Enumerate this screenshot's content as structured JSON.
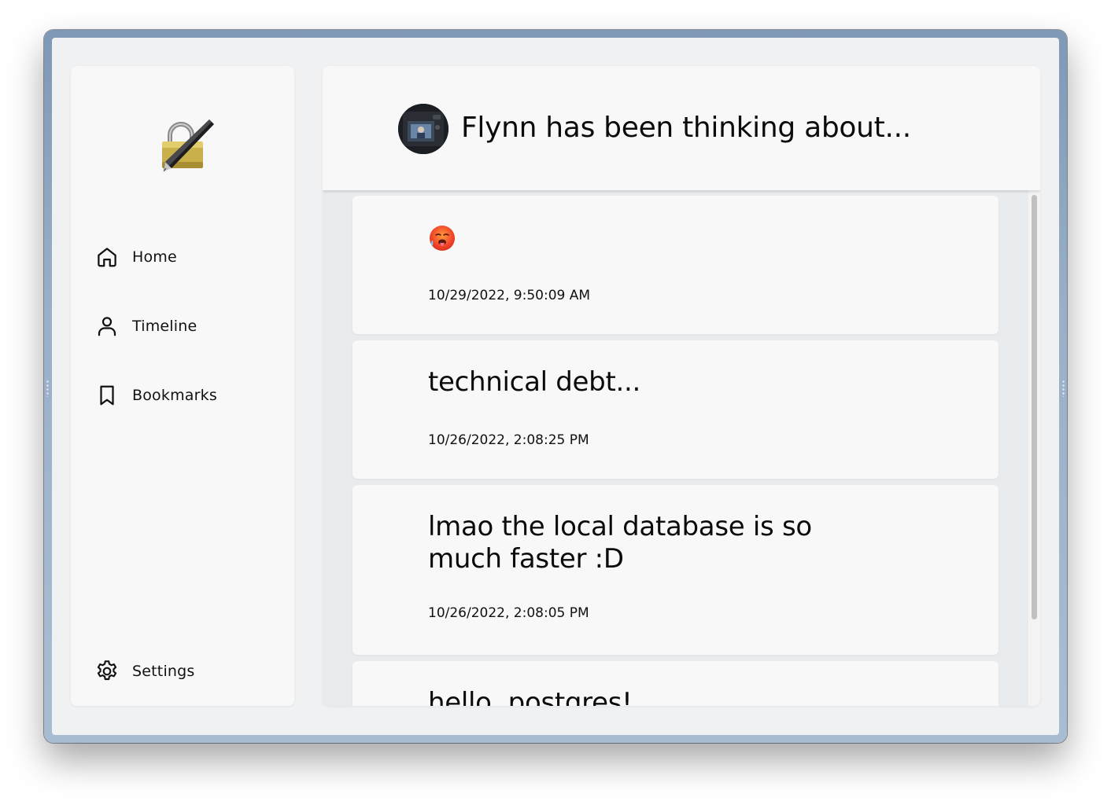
{
  "sidebar": {
    "logo": "pen-lock-logo",
    "items": [
      {
        "label": "Home",
        "icon": "home-icon"
      },
      {
        "label": "Timeline",
        "icon": "user-icon"
      },
      {
        "label": "Bookmarks",
        "icon": "bookmark-icon"
      }
    ],
    "settings": {
      "label": "Settings",
      "icon": "gear-icon"
    }
  },
  "header": {
    "title": "Flynn has been thinking about...",
    "avatar": "camera-avatar"
  },
  "posts": [
    {
      "text": "",
      "emoji": "hot-face-emoji",
      "timestamp": "10/29/2022, 9:50:09 AM"
    },
    {
      "text": "technical debt...",
      "timestamp": "10/26/2022, 2:08:25 PM"
    },
    {
      "text": "lmao the local database is so much faster :D",
      "timestamp": "10/26/2022, 2:08:05 PM"
    },
    {
      "text": "hello, postgres!",
      "timestamp": ""
    }
  ],
  "colors": {
    "window_frame": "#8fa6c0",
    "background": "#eff1f3",
    "panel": "#f8f8f8",
    "feed_background": "#e9ecef",
    "text": "#0b0b0b"
  }
}
